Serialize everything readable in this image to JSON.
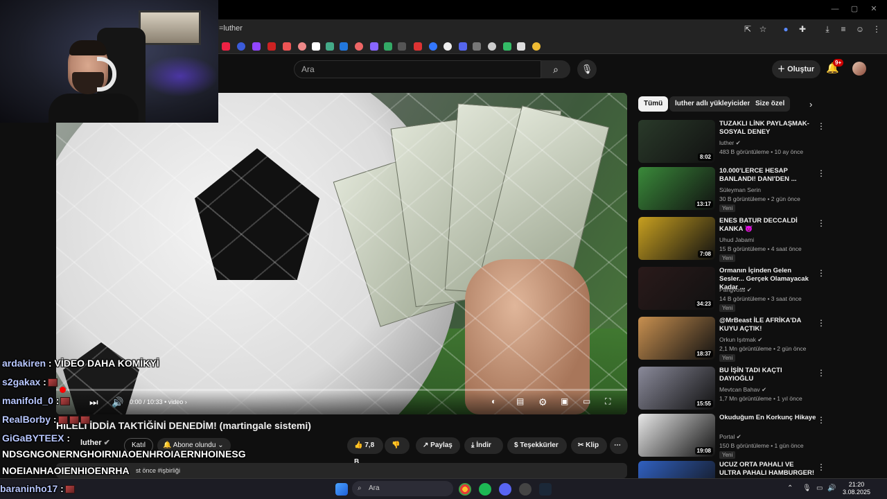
{
  "browser": {
    "url": "=luther",
    "win_min": "—",
    "win_max": "▢",
    "win_close": "✕"
  },
  "yt": {
    "search_placeholder": "Ara",
    "create_label": "Oluştur",
    "notif_count": "9+"
  },
  "video": {
    "time": "0:00 / 10:33",
    "chapter": "• video ›",
    "title": "HİLELİ İDDİA TAKTİĞİNİ DENEDİM! (martingale sistemi)",
    "progress_fraction": 0.0
  },
  "channel": {
    "name": "luther",
    "join_label": "Katıl",
    "subscribe_label": "Abone olundu"
  },
  "actions": {
    "likes": "7,8 B",
    "share": "Paylaş",
    "download": "İndir",
    "thanks": "Teşekkürler",
    "clip": "Klip"
  },
  "description": {
    "meta": "st önce  #işbirliği"
  },
  "chips": [
    {
      "label": "Tümü"
    },
    {
      "label": "luther adlı yükleyiciden"
    },
    {
      "label": "Size özel"
    }
  ],
  "recommendations": [
    {
      "title": "TUZAKLI LİNK PAYLAŞMAK- SOSYAL DENEY",
      "channel": "luther ✔",
      "meta": "483 B görüntüleme • 10 ay önce",
      "duration": "8:02",
      "new": "",
      "thumb_color": "#2a3a2a"
    },
    {
      "title": "10.000'LERCE HESAP BANLANDI! DANI'DEN ...",
      "channel": "Süleyman Serin",
      "meta": "30 B görüntüleme • 2 gün önce",
      "duration": "13:17",
      "new": "Yeni",
      "thumb_color": "#3a8a3a"
    },
    {
      "title": "ENES BATUR DECCALDİ KANKA 😈",
      "channel": "Uhud Jabami",
      "meta": "15 B görüntüleme • 4 saat önce",
      "duration": "7:08",
      "new": "Yeni",
      "thumb_color": "#c8a020"
    },
    {
      "title": "Ormanın İçinden Gelen Sesler... Gerçek Olamayacak Kadar ...",
      "channel": "Pangvoss ✔",
      "meta": "14 B görüntüleme • 3 saat önce",
      "duration": "34:23",
      "new": "Yeni",
      "thumb_color": "#2a1a1a"
    },
    {
      "title": "@MrBeast İLE AFRİKA'DA KUYU AÇTIK!",
      "channel": "Orkun Işıtmak ✔",
      "meta": "2,1 Mn görüntüleme • 2 gün önce",
      "duration": "18:37",
      "new": "Yeni",
      "thumb_color": "#c89050"
    },
    {
      "title": "BU İŞİN TADI KAÇTI DAYIOĞLU",
      "channel": "Mevtcan Bahav ✔",
      "meta": "1,7 Mn görüntüleme • 1 yıl önce",
      "duration": "15:55",
      "new": "",
      "thumb_color": "#8a8a9a"
    },
    {
      "title": "Okuduğum En Korkunç Hikaye",
      "channel": "Portal ✔",
      "meta": "150 B görüntüleme • 1 gün önce",
      "duration": "19:08",
      "new": "Yeni",
      "thumb_color": "#e8e8e8"
    },
    {
      "title": "UCUZ ORTA PAHALI VE ULTRA PAHALI HAMBURGER!",
      "channel": "",
      "meta": "",
      "duration": "",
      "new": "",
      "thumb_color": "#3060c0"
    }
  ],
  "chat": [
    {
      "user": "ardakiren",
      "msg": " : VİDEO DAHA KOMİKYİ",
      "emotes": 0
    },
    {
      "user": "s2gakax",
      "msg": " :",
      "emotes": 1
    },
    {
      "user": "manifold_0",
      "msg": " :",
      "emotes": 1
    },
    {
      "user": "RealBorby",
      "msg": " :",
      "emotes": 3
    },
    {
      "user": "GiGaBYTEEX",
      "msg": " :",
      "emotes": 0
    },
    {
      "user": "",
      "msg": "NDSGNGONERNGHOIRNIAOENHROIAERNHOINESG",
      "emotes": 0
    },
    {
      "user": "",
      "msg": "NOEIANHAOIENHIOENRHA",
      "emotes": 0
    },
    {
      "user": "baraninho17",
      "msg": " :",
      "emotes": 1
    }
  ],
  "taskbar": {
    "search_label": "Ara",
    "time": "21:20",
    "date": "3.08.2025"
  }
}
